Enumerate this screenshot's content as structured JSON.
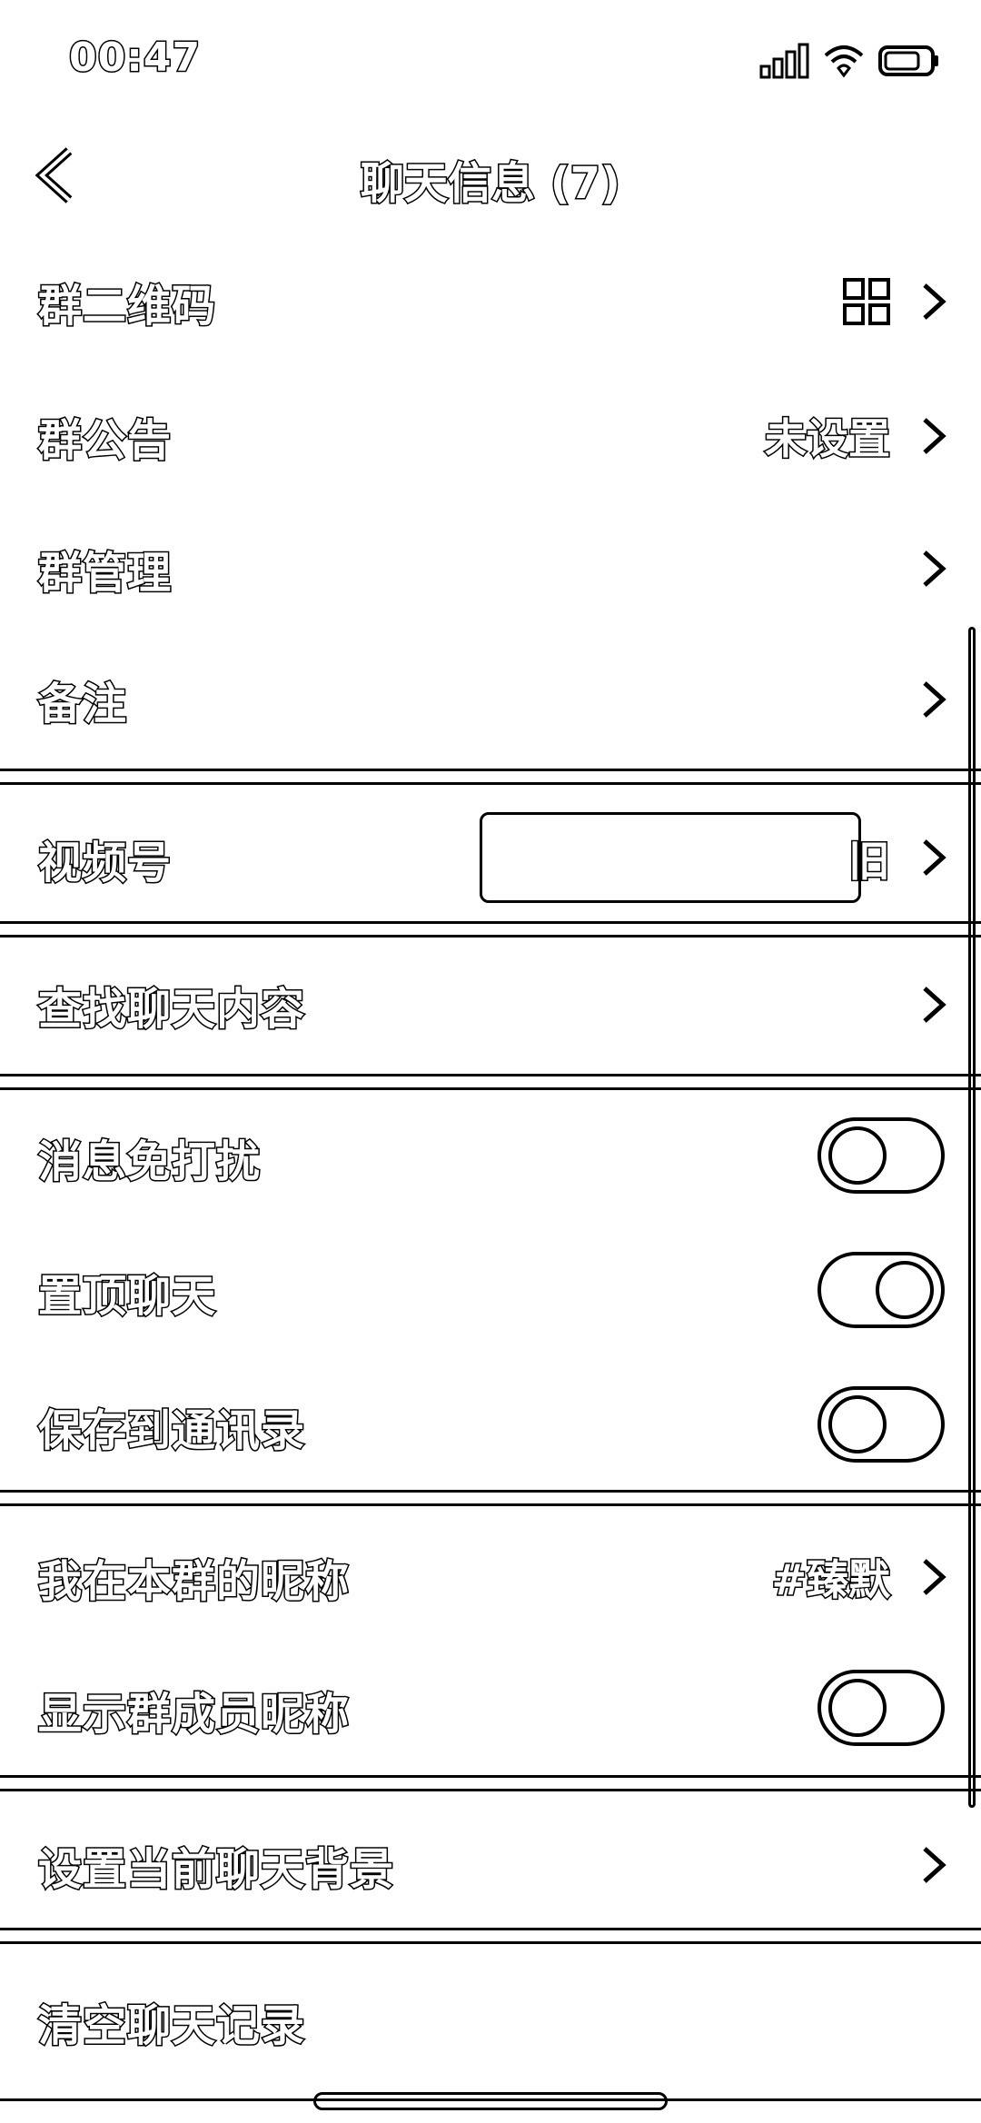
{
  "status": {
    "time": "00:47"
  },
  "nav": {
    "title": "聊天信息 (7)"
  },
  "rows": {
    "qr": {
      "label": "群二维码"
    },
    "notice": {
      "label": "群公告",
      "value": "未设置"
    },
    "manage": {
      "label": "群管理"
    },
    "remark": {
      "label": "备注"
    },
    "channels": {
      "label": "视频号",
      "value_tail": "旧"
    },
    "search": {
      "label": "查找聊天内容"
    },
    "mute": {
      "label": "消息免打扰",
      "state": "off"
    },
    "pin": {
      "label": "置顶聊天",
      "state": "on"
    },
    "save": {
      "label": "保存到通讯录",
      "state": "off"
    },
    "nickname": {
      "label": "我在本群的昵称",
      "value": "#臻默"
    },
    "show_nick": {
      "label": "显示群成员昵称",
      "state": "off"
    },
    "background": {
      "label": "设置当前聊天背景"
    },
    "clear": {
      "label": "清空聊天记录"
    }
  }
}
